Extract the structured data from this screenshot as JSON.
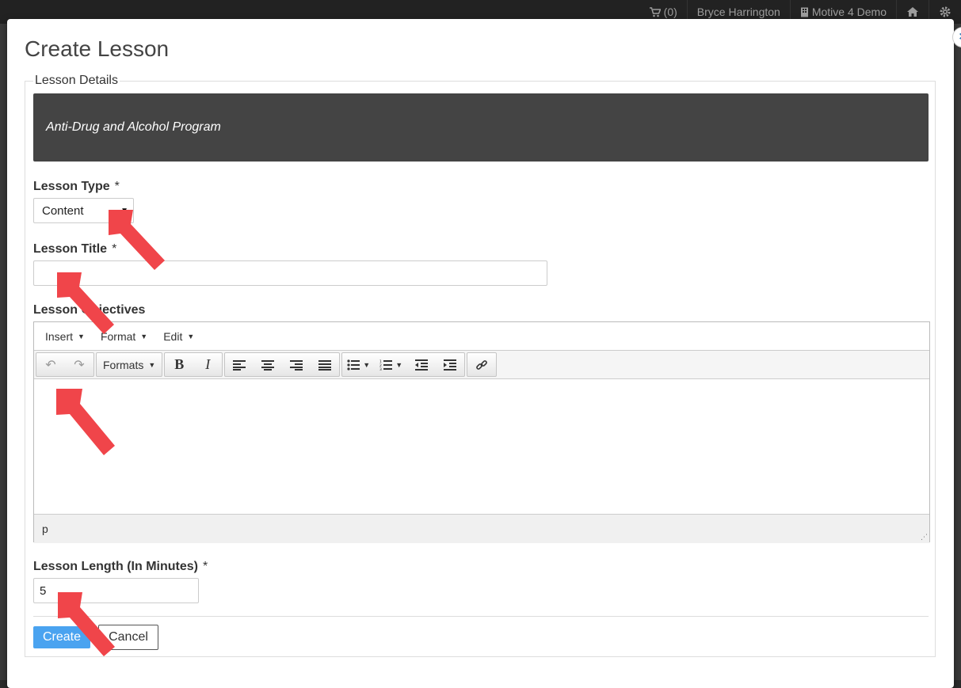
{
  "navbar": {
    "cart": "(0)",
    "user": "Bryce Harrington",
    "org": "Motive 4 Demo",
    "icons": [
      "cart-icon",
      "building-icon",
      "home-icon",
      "gear-icon"
    ]
  },
  "modal": {
    "title": "Create Lesson",
    "close_icon": "×",
    "fieldset_legend": "Lesson Details",
    "program_name": "Anti-Drug and Alcohol Program",
    "lesson_type": {
      "label": "Lesson Type",
      "required": "*",
      "value": "Content"
    },
    "lesson_title": {
      "label": "Lesson Title",
      "required": "*",
      "value": ""
    },
    "objectives": {
      "label": "Lesson Objectives",
      "menu": [
        "Insert",
        "Format",
        "Edit"
      ],
      "formats_label": "Formats",
      "status_path": "p"
    },
    "lesson_length": {
      "label": "Lesson Length (In Minutes)",
      "required": "*",
      "value": "5"
    },
    "buttons": {
      "create": "Create",
      "cancel": "Cancel"
    }
  },
  "colors": {
    "banner": "#444444",
    "primary": "#4aa3f0",
    "annotation_arrow": "#f0454a"
  }
}
